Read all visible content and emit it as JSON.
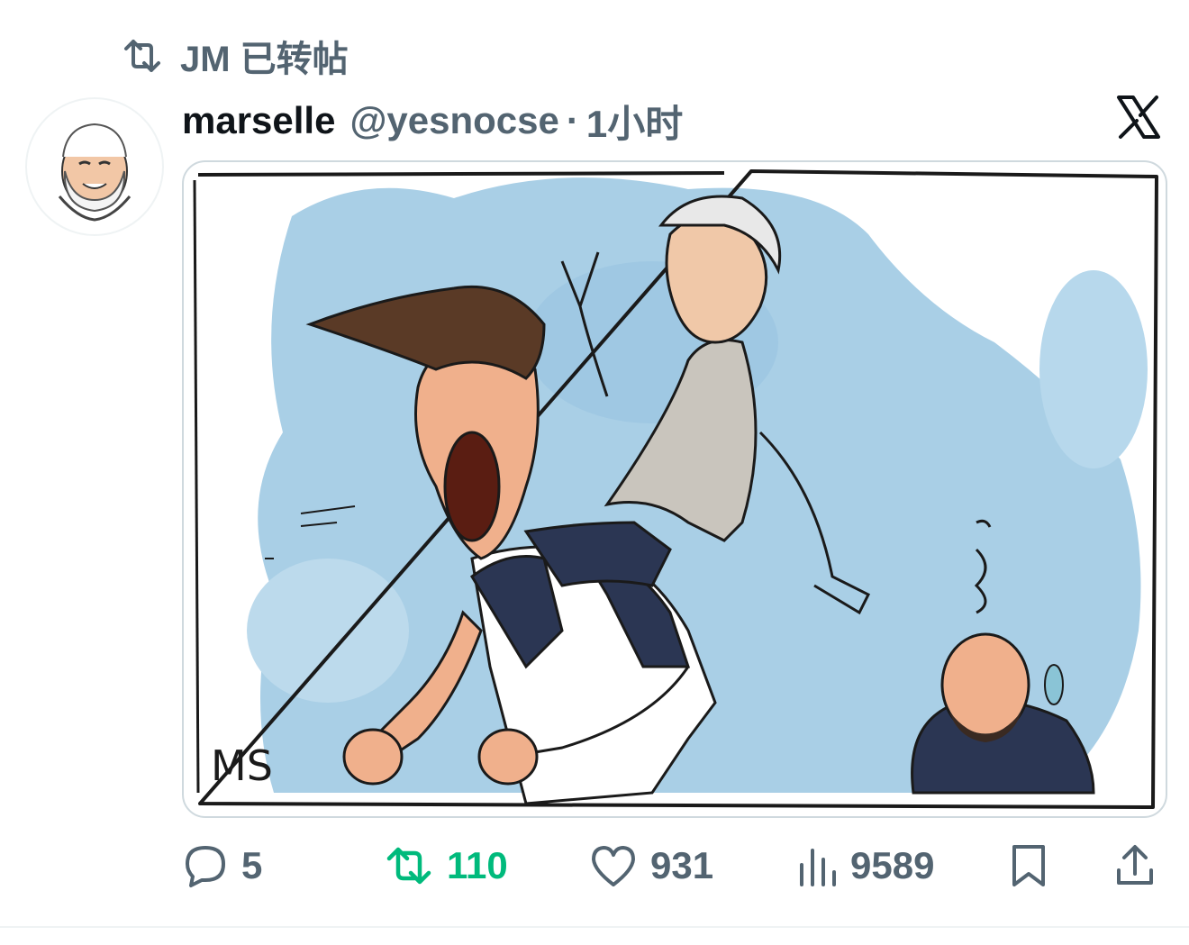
{
  "social_context": {
    "text": "JM 已转帖",
    "icon": "retweet-icon"
  },
  "author": {
    "name": "marselle",
    "handle": "@yesnocse",
    "separator": "·",
    "time": "1小时"
  },
  "platform": {
    "icon": "x-logo-icon"
  },
  "media": {
    "description": "caricature",
    "signature": "MS"
  },
  "actions": {
    "reply": {
      "count": "5",
      "icon": "reply-icon"
    },
    "retweet": {
      "count": "110",
      "icon": "retweet-icon",
      "active": true,
      "color": "#00ba7c"
    },
    "like": {
      "count": "931",
      "icon": "heart-icon"
    },
    "views": {
      "count": "9589",
      "icon": "views-icon"
    },
    "bookmark": {
      "icon": "bookmark-icon"
    },
    "share": {
      "icon": "share-icon"
    }
  },
  "colors": {
    "text_primary": "#0f1419",
    "text_secondary": "#536471",
    "retweet_active": "#00ba7c",
    "sky": "#a9cfe6"
  }
}
